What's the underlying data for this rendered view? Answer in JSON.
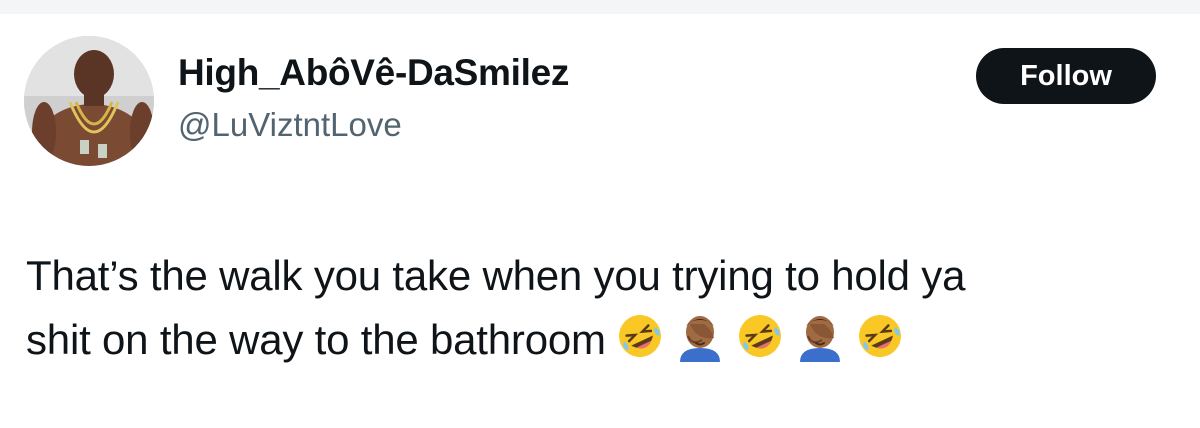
{
  "header": {
    "display_name": "High_AbôVê-DaSmilez",
    "handle": "@LuViztntLove",
    "follow_label": "Follow"
  },
  "tweet": {
    "line1": "That’s the walk you take when you trying to hold ya",
    "line2": "shit on the way to the bathroom",
    "emojis": [
      "rolling-on-floor-laughing",
      "man-facepalming",
      "rolling-on-floor-laughing",
      "man-facepalming",
      "rolling-on-floor-laughing"
    ]
  },
  "colors": {
    "text": "#0f1419",
    "handle": "#536471",
    "button_bg": "#0f1419",
    "button_text": "#ffffff",
    "emoji_yellow": "#f9c825",
    "emoji_skin": "#a06a42"
  }
}
